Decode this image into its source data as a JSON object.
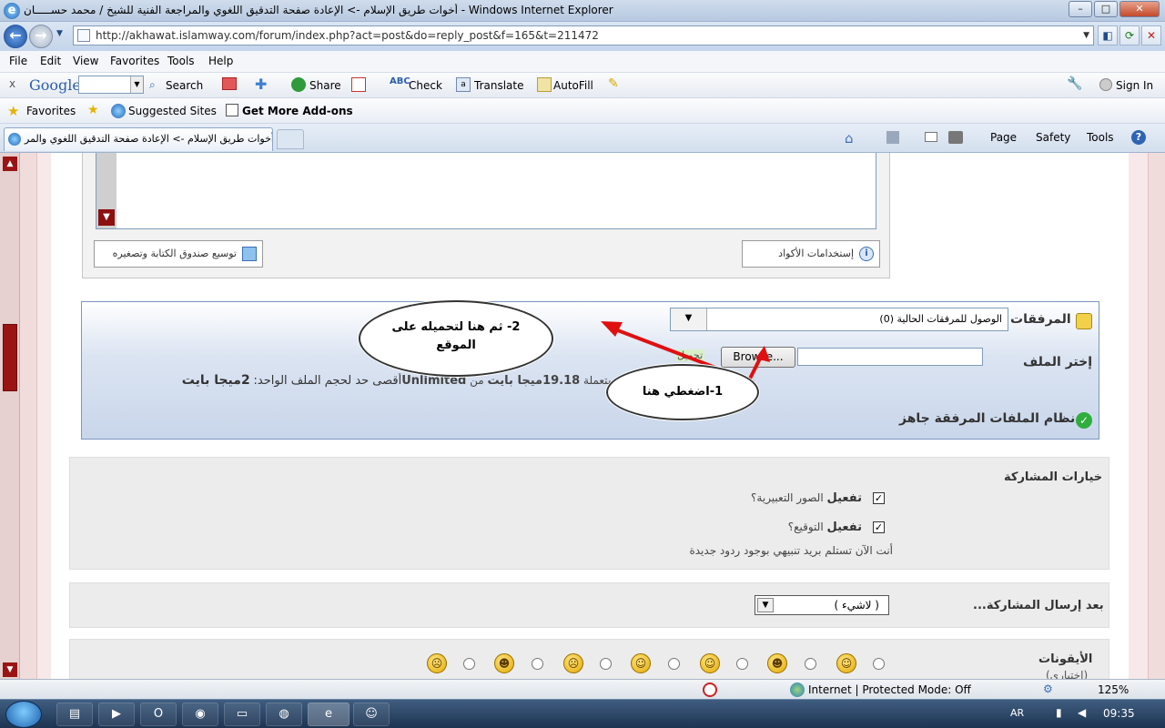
{
  "window": {
    "title": "أخوات طريق الإسلام -> الإعادة صفحة التدقيق اللغوي والمراجعة الفنية للشيخ / محمد حســـــان - Windows Internet Explorer",
    "minimize": "–",
    "maximize": "□",
    "close": "✕"
  },
  "address": {
    "url": "http://akhawat.islamway.com/forum/index.php?act=post&do=reply_post&f=165&t=211472",
    "back": "←",
    "forward": "→"
  },
  "menubar": {
    "items": [
      "File",
      "Edit",
      "View",
      "Favorites",
      "Tools",
      "Help"
    ]
  },
  "google_toolbar": {
    "close": "x",
    "logo": "Google",
    "search": "Search",
    "share": "Share",
    "check": "Check",
    "translate": "Translate",
    "autofill": "AutoFill",
    "sign_in": "Sign In"
  },
  "favorites_bar": {
    "favorites": "Favorites",
    "suggested": "Suggested Sites",
    "addons": "Get More Add-ons"
  },
  "tabs": {
    "active": "أخوات طريق الإسلام -> الإعادة صفحة التدقيق اللغوي والمر...",
    "page": "Page",
    "safety": "Safety",
    "tools": "Tools"
  },
  "editor": {
    "resize_label": "توسيع صندوق الكتابة وتصغيره",
    "codes_label": "إستخدامات الأكواد"
  },
  "attachments": {
    "title": "المرفقات",
    "select_value": "الوصول للمرفقات الحالية (0)",
    "choose_file": "إختر الملف",
    "browse": "Browse...",
    "upload": "تحميل",
    "usage_prefix": "مساحة المرفقات المستعملة",
    "used": "19.18ميجا بايت",
    "from": "من",
    "unlimited": "Unlimited",
    "max_label": "أقصى حد لحجم الملف الواحد:",
    "max_value": "2ميجا بايت",
    "ready": "نظام الملفات المرفقة جاهز"
  },
  "callouts": {
    "step1": "1-اضغطي هنا",
    "step2": "2- ثم هنا لتحميله على الموقع"
  },
  "post_options": {
    "heading": "خيارات المشاركة",
    "emoticons_bold": "تفعيل",
    "emoticons_rest": "الصور التعبيرية؟",
    "signature_bold": "تفعيل",
    "signature_rest": "التوقيع؟",
    "notify": "أنت الآن تستلم بريد تنبيهي بوجود ردود جديدة",
    "checked": "✓"
  },
  "after_post": {
    "label": "بعد إرسال المشاركة...",
    "value": "( لاشيء )"
  },
  "icons_section": {
    "label": "الأيقونات",
    "optional": "(اختياري)"
  },
  "statusbar": {
    "zone": "Internet | Protected Mode: Off",
    "zoom": "125%"
  },
  "taskbar": {
    "lang": "AR",
    "time": "09:35"
  },
  "colors": {
    "accent_red": "#9b1414",
    "attach_blue": "#c9d6ea",
    "arrow_red": "#e01010"
  }
}
